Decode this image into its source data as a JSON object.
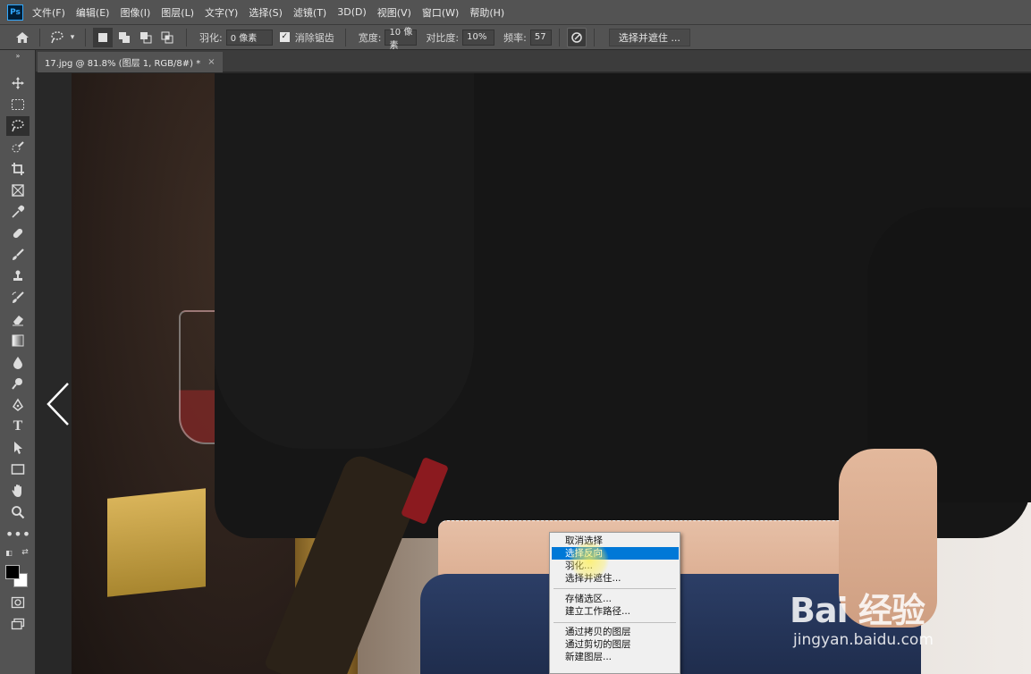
{
  "app": {
    "logo": "Ps"
  },
  "menu": [
    "文件(F)",
    "编辑(E)",
    "图像(I)",
    "图层(L)",
    "文字(Y)",
    "选择(S)",
    "滤镜(T)",
    "3D(D)",
    "视图(V)",
    "窗口(W)",
    "帮助(H)"
  ],
  "options": {
    "feather_label": "羽化:",
    "feather_value": "0 像素",
    "antialias_label": "消除锯齿",
    "width_label": "宽度:",
    "width_value": "10 像素",
    "contrast_label": "对比度:",
    "contrast_value": "10%",
    "frequency_label": "频率:",
    "frequency_value": "57",
    "refine_button": "选择并遮住 ..."
  },
  "document": {
    "tab_title": "17.jpg @ 81.8% (图层 1, RGB/8#) *",
    "close": "×"
  },
  "context_menu": {
    "items": [
      {
        "label": "取消选择"
      },
      {
        "label": "选择反向",
        "highlighted": true
      },
      {
        "label": "羽化..."
      },
      {
        "label": "选择并遮住..."
      },
      {
        "label": "存储选区..."
      },
      {
        "label": "建立工作路径..."
      },
      {
        "label": "通过拷贝的图层"
      },
      {
        "label": "通过剪切的图层"
      },
      {
        "label": "新建图层..."
      }
    ]
  },
  "watermark": {
    "logo": "Bai 经验",
    "url": "jingyan.baidu.com"
  },
  "colors": {
    "highlight": "#0078d7",
    "panel": "#535353",
    "canvas": "#282828"
  }
}
